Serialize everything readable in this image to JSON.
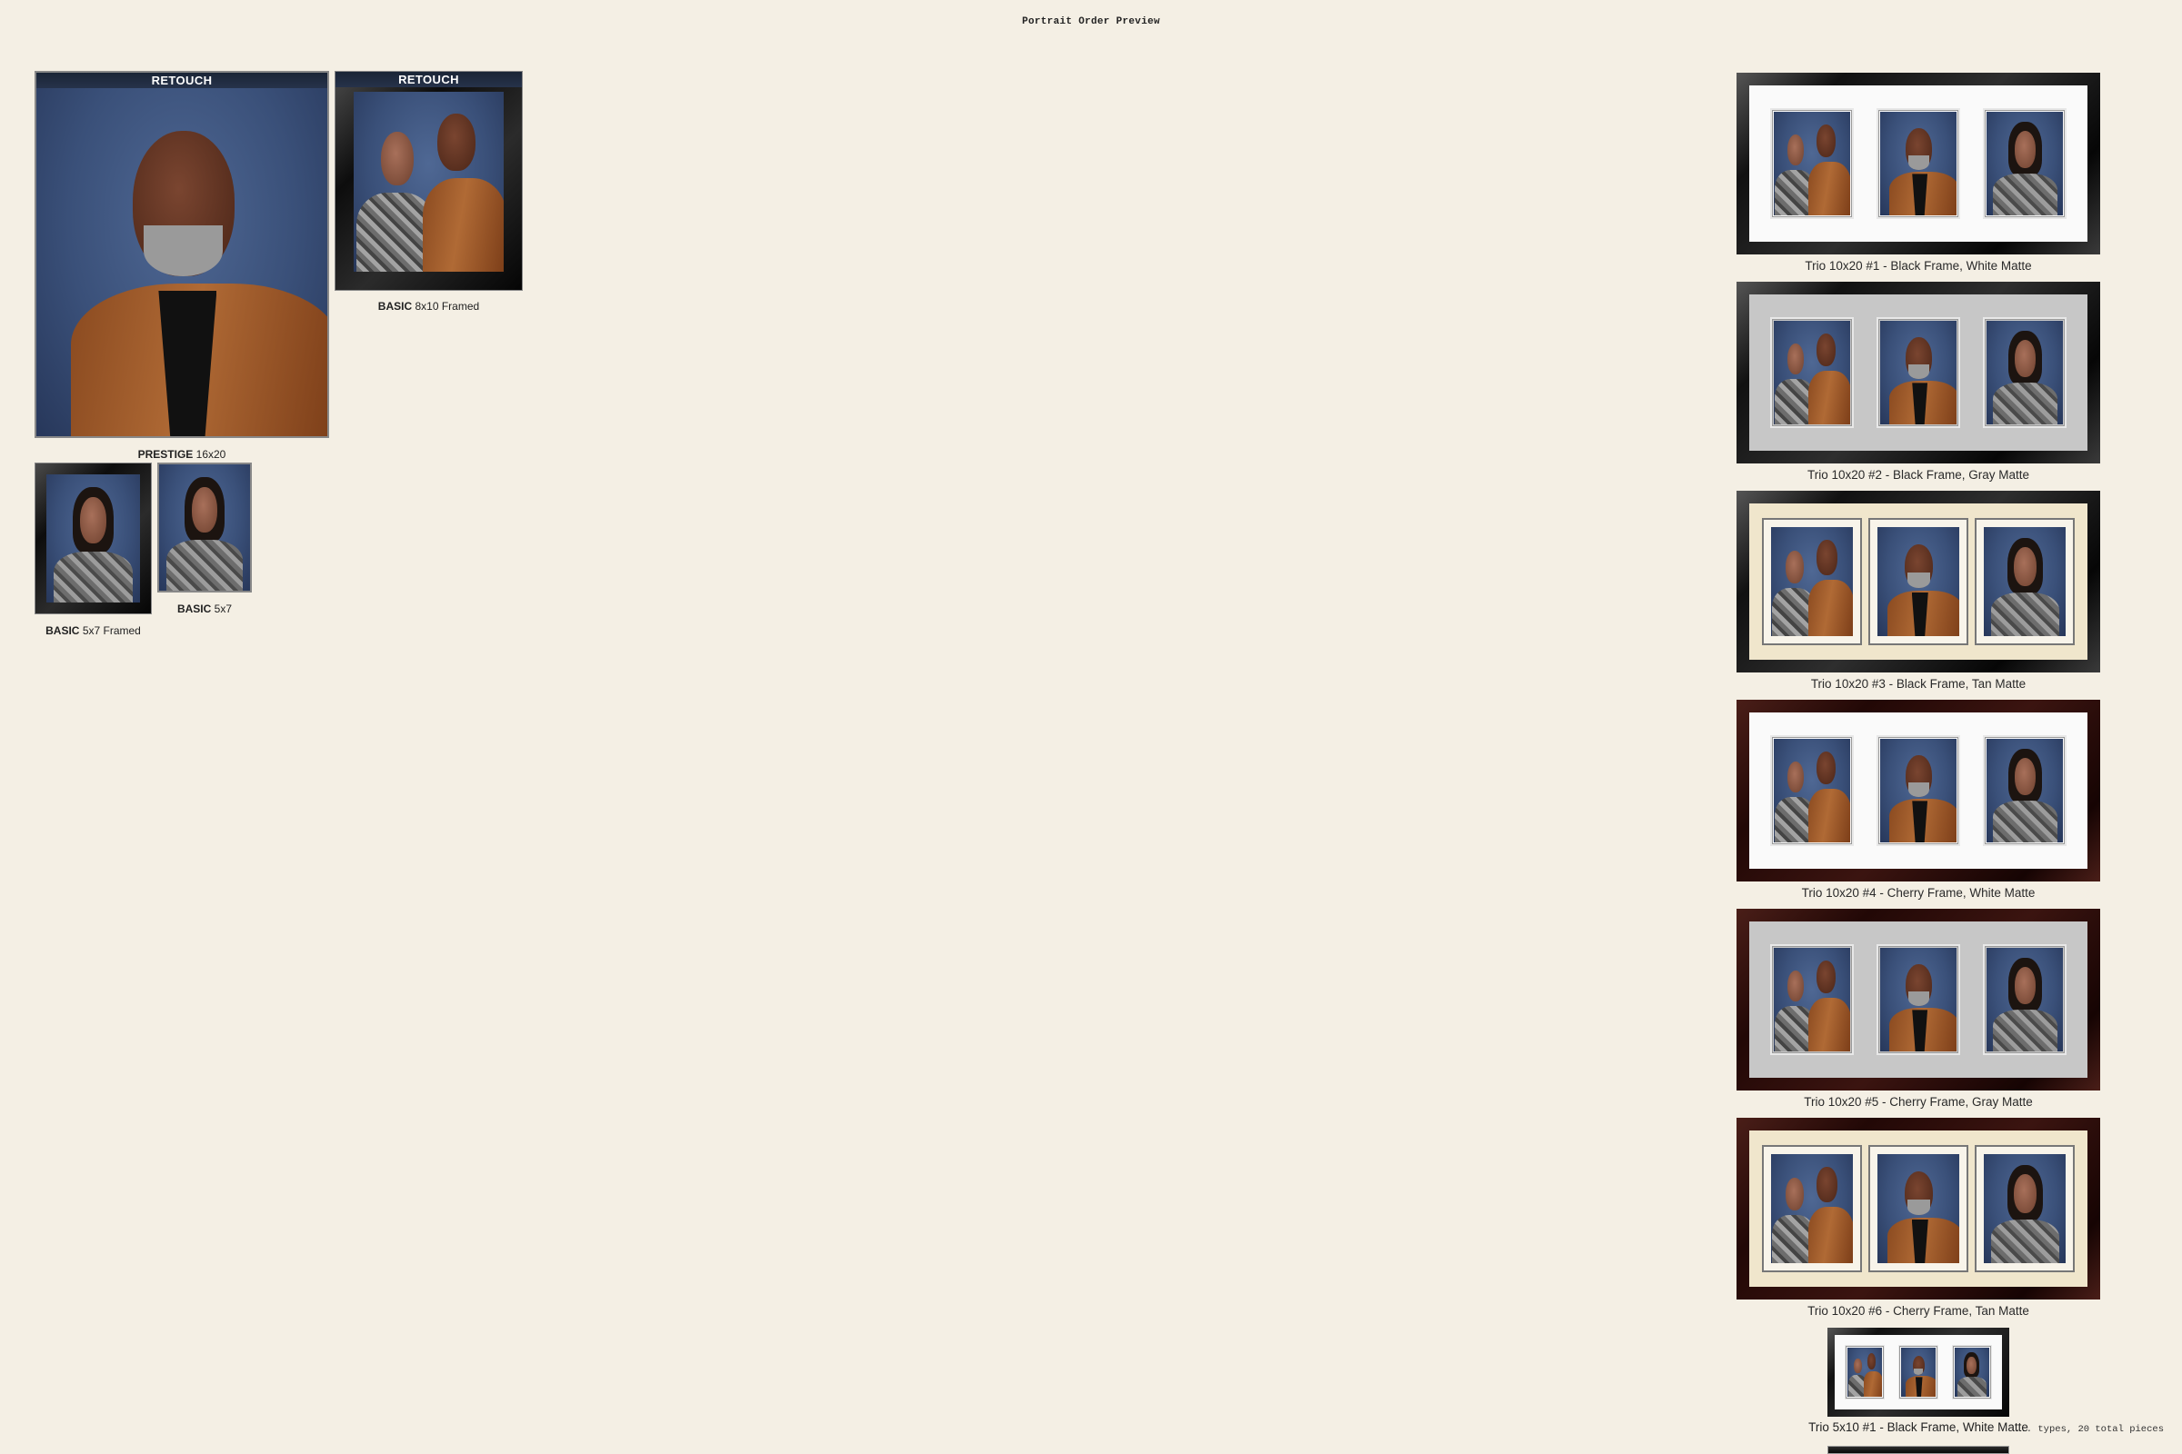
{
  "page": {
    "title": "Portrait Order Preview"
  },
  "left_products": [
    {
      "label": "RETOUCH",
      "tier": "PRESTIGE",
      "size": "16x20"
    },
    {
      "label": "RETOUCH",
      "tier": "BASIC",
      "size": "8x10 Framed"
    },
    {
      "tier": "BASIC",
      "size": "5x7 Framed"
    },
    {
      "tier": "BASIC",
      "size": "5x7"
    }
  ],
  "trios": [
    {
      "caption": "Trio 10x20 #1 - Black Frame, White Matte",
      "frame_color": "#111111",
      "matte_color": "#fafafa"
    },
    {
      "caption": "Trio 10x20 #2 - Black Frame, Gray Matte",
      "frame_color": "#111111",
      "matte_color": "#c7c7c7"
    },
    {
      "caption": "Trio 10x20 #3 - Black Frame, Tan Matte",
      "frame_color": "#111111",
      "matte_color": "#f0e6cc"
    },
    {
      "caption": "Trio 10x20 #4 - Cherry Frame, White Matte",
      "frame_color": "#2a0a08",
      "matte_color": "#fafafa"
    },
    {
      "caption": "Trio 10x20 #5 - Cherry Frame, Gray Matte",
      "frame_color": "#2a0a08",
      "matte_color": "#c7c7c7"
    },
    {
      "caption": "Trio 10x20 #6 - Cherry Frame, Tan Matte",
      "frame_color": "#2a0a08",
      "matte_color": "#f0e6cc"
    },
    {
      "caption": "Trio 5x10 #1 - Black Frame, White Matte",
      "frame_color": "#111111",
      "matte_color": "#fafafa"
    }
  ],
  "footer": {
    "summary": "... types, 20 total pieces"
  },
  "colors": {
    "background": "#f4efe4",
    "retouch_bar": "#1f2b40"
  }
}
